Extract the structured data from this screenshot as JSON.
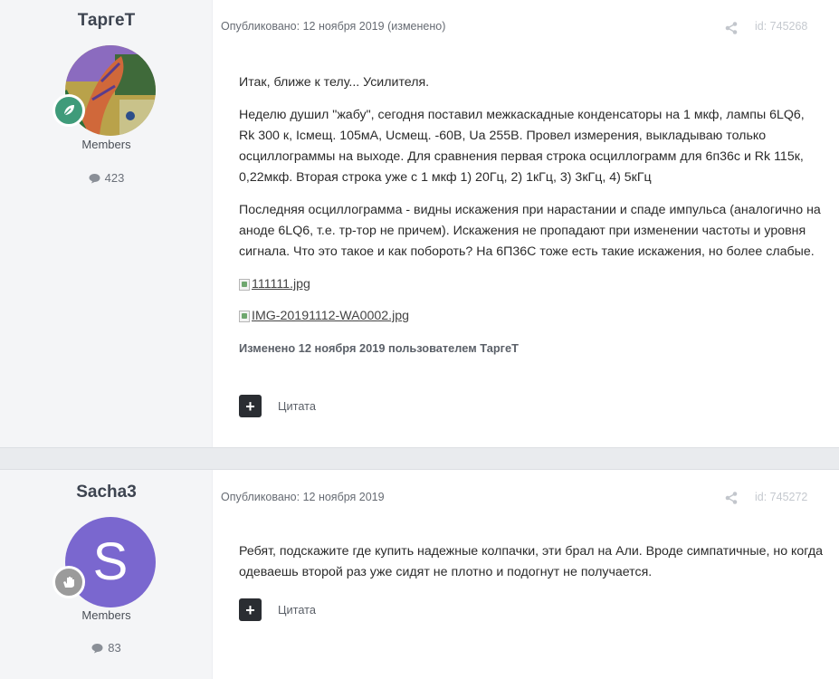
{
  "posts": [
    {
      "author": {
        "name": "ТаргеТ",
        "group": "Members",
        "post_count": "423",
        "badge_icon": "leaf-icon",
        "badge_color": "#3f9b7a"
      },
      "meta": "Опубликовано: 12 ноября 2019 (изменено)",
      "post_id": "id: 745268",
      "paragraphs": [
        "Итак, ближе к телу... Усилителя.",
        "Неделю душил \"жабу\", сегодня поставил межкаскадные конденсаторы на 1 мкф, лампы 6LQ6, Rk 300 к, Icмещ. 105мА, Ucмещ. -60В, Ua 255В. Провел измерения, выкладываю только осциллограммы на выходе. Для сравнения первая строка осциллограмм для 6п36с и Rk 115к, 0,22мкф. Вторая строка уже с 1 мкф 1) 20Гц, 2) 1кГц, 3) 3кГц, 4) 5кГц",
        "Последняя осциллограмма - видны искажения при нарастании и спаде импульса (аналогично на аноде   6LQ6, т.е. тр-тор не причем). Искажения не пропадают при изменении частоты и уровня сигнала. Что это такое и как побороть? На 6П36С тоже есть такие искажения, но более слабые."
      ],
      "attachments": [
        "111111.jpg",
        "IMG-20191112-WA0002.jpg"
      ],
      "edited_note": "Изменено 12 ноября 2019 пользователем ТаргеТ",
      "quote_label": "Цитата"
    },
    {
      "author": {
        "name": "Sacha3",
        "group": "Members",
        "post_count": "83",
        "avatar_letter": "S",
        "avatar_color": "#7a67cf",
        "badge_icon": "hand-icon",
        "badge_color": "#9b9b9b"
      },
      "meta": "Опубликовано: 12 ноября 2019",
      "post_id": "id: 745272",
      "paragraphs": [
        "Ребят, подскажите где купить надежные колпачки, эти брал на Али. Вроде симпатичные, но когда одеваешь второй раз уже сидят не плотно и подогнут не получается."
      ],
      "quote_label": "Цитата"
    }
  ]
}
